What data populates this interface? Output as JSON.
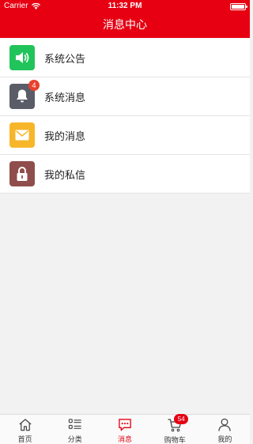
{
  "status_bar": {
    "carrier": "Carrier",
    "time": "11:32 PM"
  },
  "header": {
    "title": "消息中心"
  },
  "menu": [
    {
      "label": "系统公告",
      "icon": "speaker-icon",
      "color": "#21c45a"
    },
    {
      "label": "系统消息",
      "icon": "bell-icon",
      "color": "#5a5c68",
      "badge": "4"
    },
    {
      "label": "我的消息",
      "icon": "envelope-icon",
      "color": "#f7b62a"
    },
    {
      "label": "我的私信",
      "icon": "lock-icon",
      "color": "#8f4e4b"
    }
  ],
  "tab_bar": {
    "active": "消息",
    "tabs": [
      {
        "label": "首页",
        "icon": "home-icon"
      },
      {
        "label": "分类",
        "icon": "list-icon"
      },
      {
        "label": "消息",
        "icon": "message-icon"
      },
      {
        "label": "购物车",
        "icon": "cart-icon",
        "badge": "54"
      },
      {
        "label": "我的",
        "icon": "user-icon"
      }
    ]
  },
  "colors": {
    "brand": "#e60012",
    "background": "#f2f2f2"
  }
}
